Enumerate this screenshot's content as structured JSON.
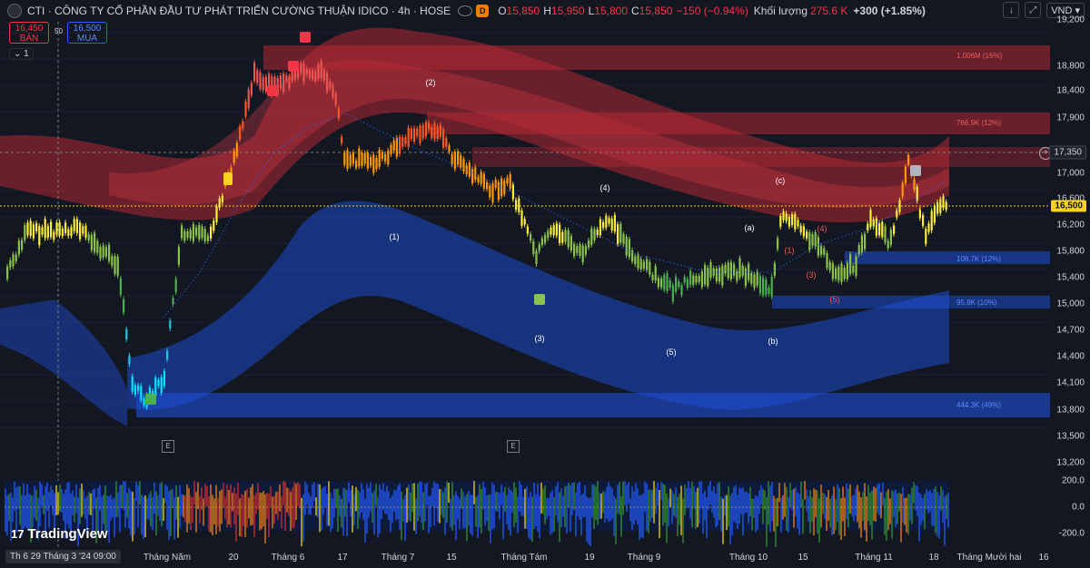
{
  "header": {
    "title": "CTI · CÔNG TY CỔ PHẦN ĐẦU TƯ PHÁT TRIỂN CƯỜNG THUẬN IDICO · 4h · HOSE",
    "badge": "D",
    "open_key": "O",
    "open": "15,850",
    "high_key": "H",
    "high": "15,950",
    "low_key": "L",
    "low": "15,800",
    "close_key": "C",
    "close": "15,850",
    "change": "−150 (−0.94%)",
    "volume_label": "Khối lượng",
    "volume": "275.6 K",
    "volume_change": "+300 (+1.85%)",
    "currency": "VND"
  },
  "trade": {
    "sell_price": "16,450",
    "sell_label": "BÁN",
    "spread": "50",
    "buy_price": "16,500",
    "buy_label": "MUA"
  },
  "indicator_tag": "1",
  "y_axis": [
    "19,200",
    "18,800",
    "18,400",
    "17,900",
    "17,350",
    "17,000",
    "16,600",
    "16,200",
    "15,800",
    "15,400",
    "15,000",
    "14,700",
    "14,400",
    "14,100",
    "13,800",
    "13,500",
    "13,200"
  ],
  "current_price_tag": "16,500",
  "cursor_price_tag": "17,350",
  "oscillator_axis": [
    "200.0",
    "0.0",
    "-200.0"
  ],
  "zones": [
    {
      "label": "1.006M (16%)",
      "color": "#f05a5a"
    },
    {
      "label": "766.9K (12%)",
      "color": "#f05a5a"
    },
    {
      "label": "108.7K (12%)",
      "color": "#5b8cff"
    },
    {
      "label": "95.9K (10%)",
      "color": "#5b8cff"
    },
    {
      "label": "444.3K (49%)",
      "color": "#5b8cff"
    }
  ],
  "waves": [
    "(2)",
    "(4)",
    "(c)",
    "(a)",
    "(1)",
    "(3)",
    "(5)",
    "(b)",
    "(1)",
    "(3)",
    "(4)",
    "(5)"
  ],
  "markers": [
    "E",
    "E"
  ],
  "x_axis": [
    "Tháng Năm",
    "20",
    "Tháng 6",
    "17",
    "Tháng 7",
    "15",
    "Tháng Tám",
    "19",
    "Tháng 9",
    "Tháng 10",
    "15",
    "Tháng 11",
    "18",
    "Tháng Mười hai",
    "16"
  ],
  "x_cursor": "Th 6 29 Tháng 3 '24   09:00",
  "brand": "TradingView",
  "colors": {
    "bg": "#131722",
    "bull": "#26a69a",
    "bear": "#f23645",
    "supply": "#b22833",
    "demand": "#1e4fd8",
    "accent": "#f7d21e"
  }
}
